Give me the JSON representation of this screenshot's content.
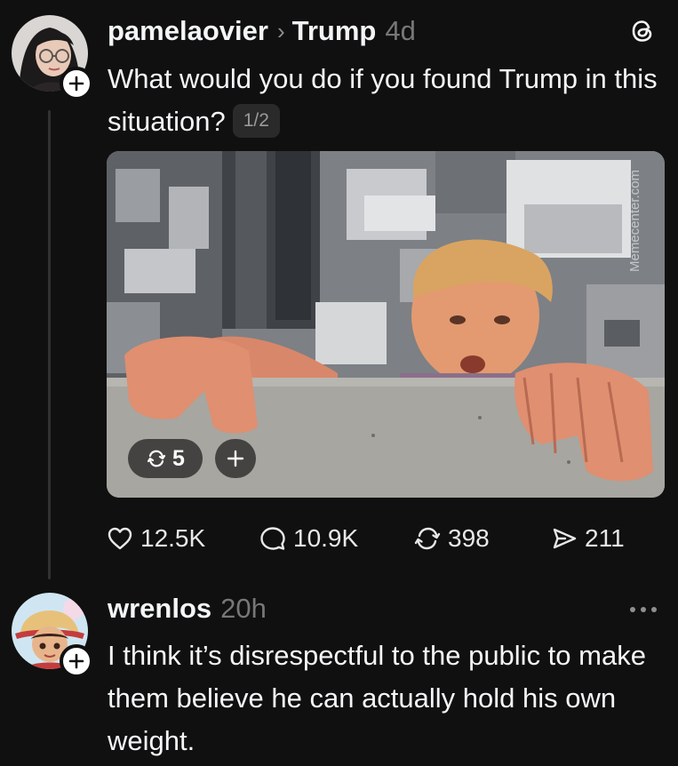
{
  "post": {
    "username": "pamelaovier",
    "topic": "Trump",
    "time": "4d",
    "text": "What would you do if you found Trump in this situation?",
    "media_counter": "1/2",
    "media_watermark": "Memecenter.com",
    "remix_count": "5",
    "likes": "12.5K",
    "replies": "10.9K",
    "reposts": "398",
    "shares": "211"
  },
  "reply": {
    "username": "wrenlos",
    "time": "20h",
    "text": "I think it’s disrespectful to the public to make them believe he can actually hold his own weight."
  },
  "icons": {
    "app": "threads-logo-icon",
    "follow": "plus-icon",
    "like": "heart-icon",
    "comment": "comment-bubble-icon",
    "repost": "repost-icon",
    "share": "send-icon",
    "more": "more-dots-icon"
  },
  "colors": {
    "background": "#101010",
    "text": "#f3f5f7",
    "secondary": "#777777",
    "thread_line": "#323232"
  }
}
